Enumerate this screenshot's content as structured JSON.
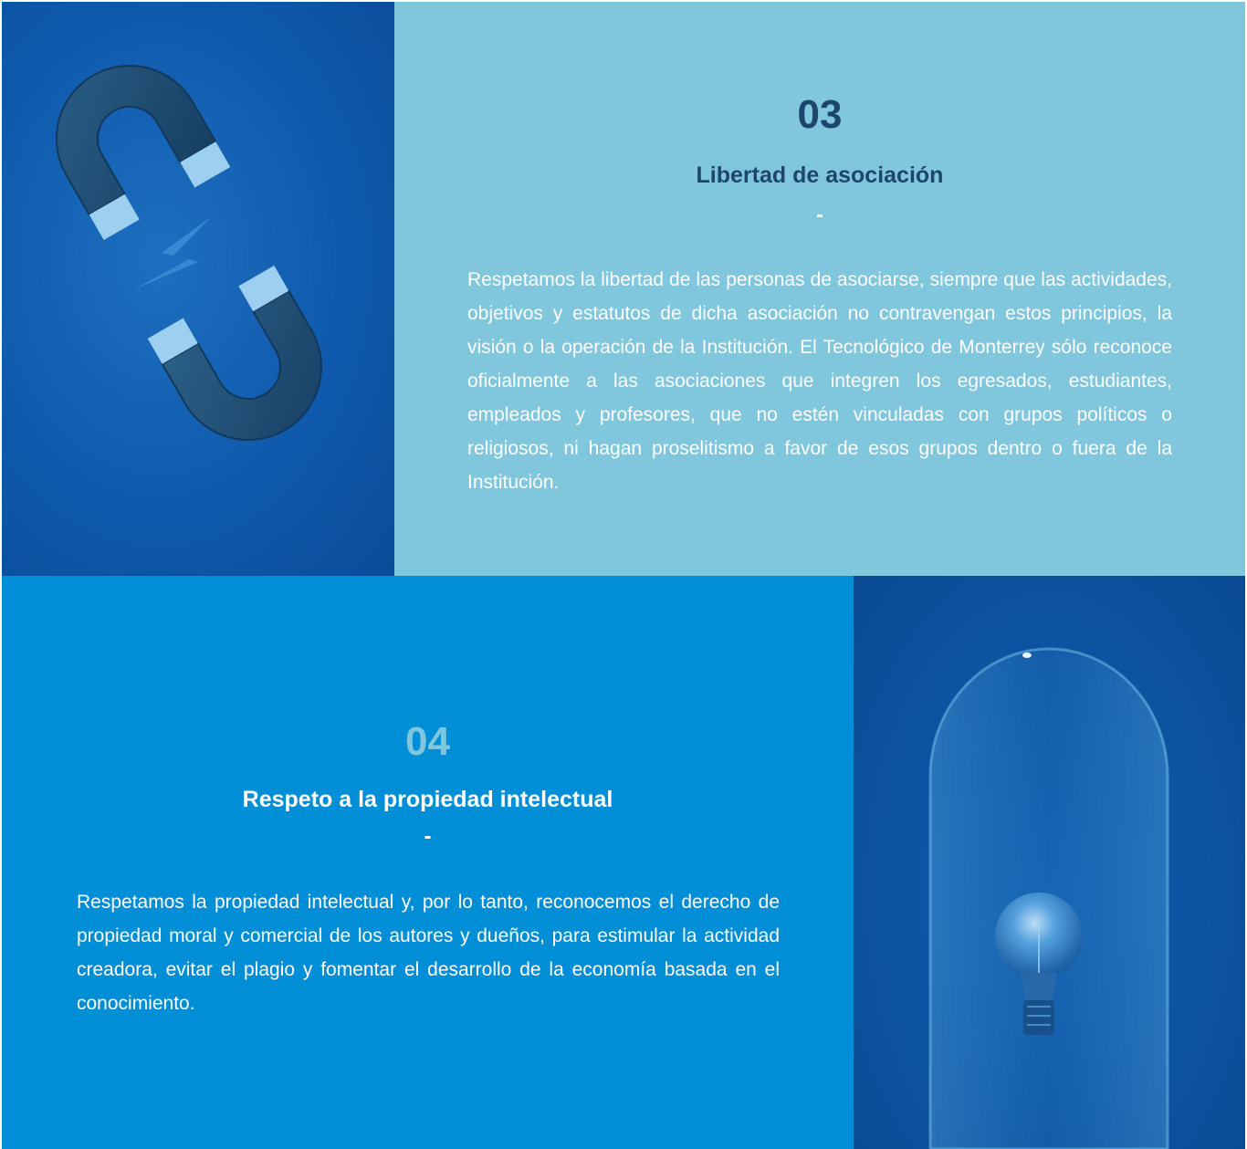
{
  "sections": [
    {
      "number": "03",
      "title": "Libertad de asociación",
      "separator": "-",
      "body": "Respetamos la libertad de las personas de asociarse, siempre que las actividades, objetivos y estatutos de dicha asociación no contravengan estos principios, la visión o la operación de la Institución. El Tecnológico de Monterrey sólo reconoce oficialmente a las asociaciones que integren los egresados, estudiantes, empleados y profesores, que no estén vinculadas con grupos políticos o religiosos, ni hagan proselitismo a favor de esos grupos dentro o fuera de la Institución.",
      "image_icon": "magnets-icon",
      "colors": {
        "panel": "#80c7de",
        "number": "#1e466c",
        "title": "#1e466c"
      }
    },
    {
      "number": "04",
      "title": "Respeto a la propiedad intelectual",
      "separator": "-",
      "body": "Respetamos la propiedad intelectual y, por lo tanto, reconocemos el derecho de propiedad moral y comercial de los autores y dueños, para estimular la actividad creadora, evitar el plagio y fomentar el desarrollo de la economía basada en el conocimiento.",
      "image_icon": "lightbulb-in-glass-dome-icon",
      "colors": {
        "panel": "#008ed6",
        "number": "#80c7de",
        "title": "#ffffff"
      }
    }
  ]
}
